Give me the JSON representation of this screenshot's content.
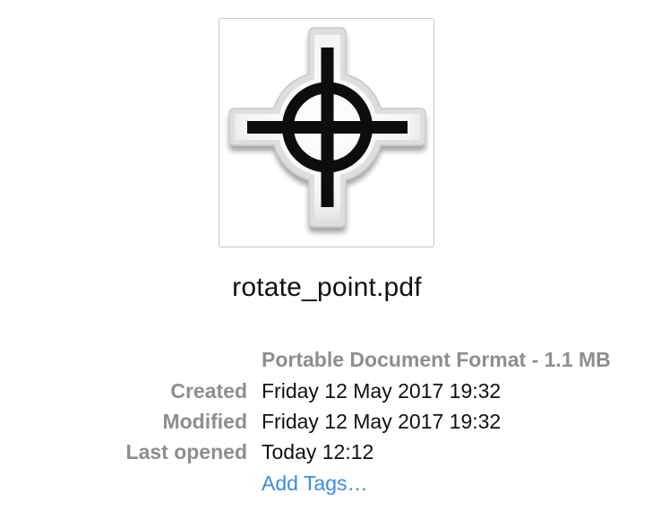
{
  "file": {
    "name": "rotate_point.pdf",
    "icon": "crosshair-rotate-point-icon",
    "kind_size": "Portable Document Format - 1.1 MB"
  },
  "info": {
    "created": {
      "label": "Created",
      "value": "Friday 12 May 2017 19:32"
    },
    "modified": {
      "label": "Modified",
      "value": "Friday 12 May 2017 19:32"
    },
    "last_opened": {
      "label": "Last opened",
      "value": "Today 12:12"
    }
  },
  "tags": {
    "add_label": "Add Tags…"
  },
  "colors": {
    "label_gray": "#8e8e8e",
    "link_blue": "#3a8de0",
    "text": "#111111"
  }
}
